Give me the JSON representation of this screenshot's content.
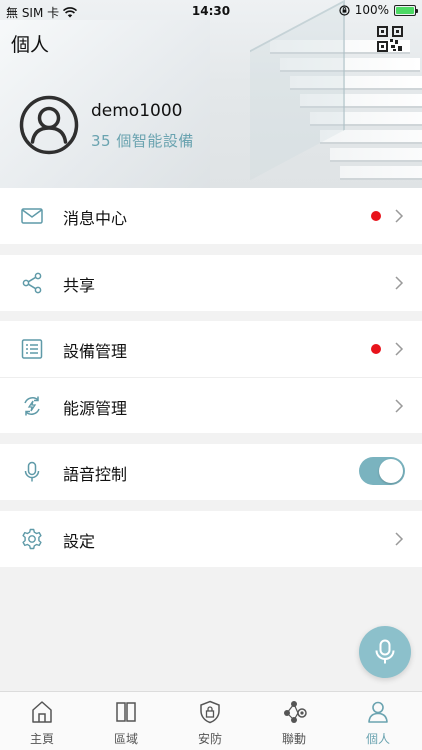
{
  "status_bar": {
    "carrier": "無 SIM 卡",
    "time": "14:30",
    "battery": "100%",
    "battery_level": 1.0
  },
  "header": {
    "title": "個人",
    "qr_icon": "qr-code-icon",
    "username": "demo1000",
    "device_count": "35 個智能設備"
  },
  "menu": [
    {
      "label": "消息中心",
      "icon": "mail-icon",
      "badge": true,
      "control": "chevron"
    },
    {
      "label": "共享",
      "icon": "share-icon",
      "badge": false,
      "control": "chevron"
    },
    {
      "label": "設備管理",
      "icon": "list-icon",
      "badge": true,
      "control": "chevron"
    },
    {
      "label": "能源管理",
      "icon": "energy-icon",
      "badge": false,
      "control": "chevron"
    },
    {
      "label": "語音控制",
      "icon": "microphone-icon",
      "badge": false,
      "control": "toggle",
      "toggle_on": true
    },
    {
      "label": "設定",
      "icon": "gear-icon",
      "badge": false,
      "control": "chevron"
    }
  ],
  "tabs": [
    {
      "label": "主頁",
      "icon": "home-icon",
      "active": false
    },
    {
      "label": "區域",
      "icon": "area-icon",
      "active": false
    },
    {
      "label": "安防",
      "icon": "security-shield-icon",
      "active": false
    },
    {
      "label": "聯動",
      "icon": "linkage-icon",
      "active": false
    },
    {
      "label": "個人",
      "icon": "person-icon",
      "active": true
    }
  ],
  "colors": {
    "accent": "#6aa3b0",
    "toggle_on": "#7ab3bf",
    "badge_red": "#e8131b",
    "fab": "#8cc0cb"
  }
}
